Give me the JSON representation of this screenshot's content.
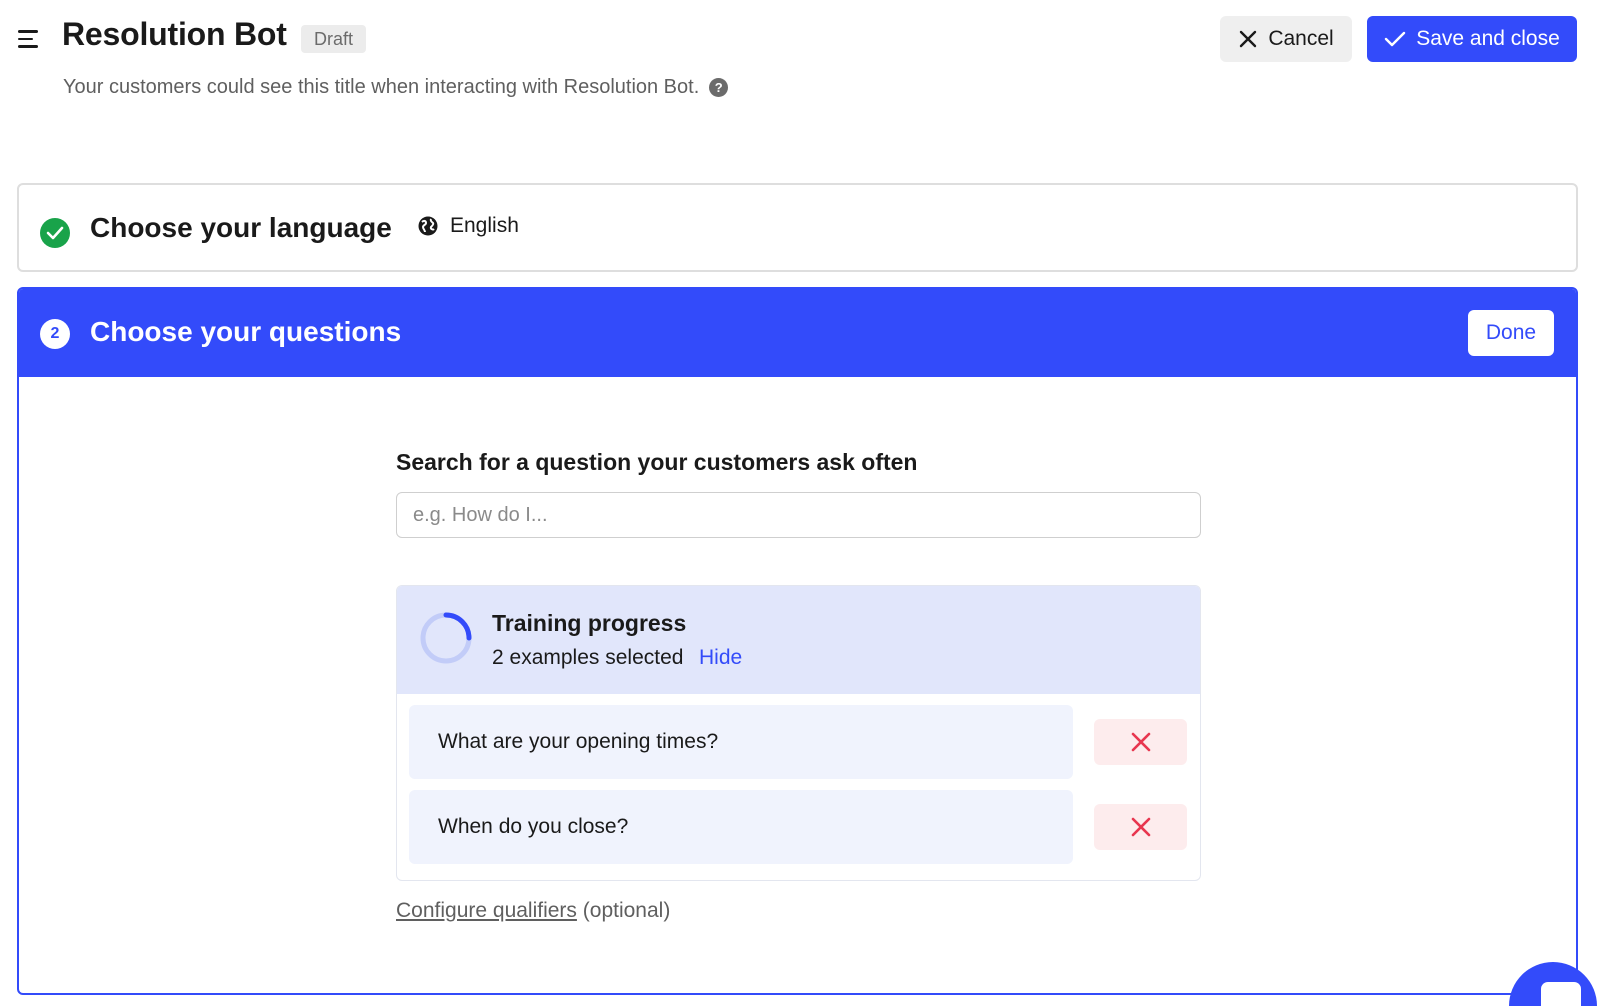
{
  "header": {
    "menu_icon": "hamburger-icon",
    "title": "Resolution Bot",
    "badge": "Draft",
    "subtitle": "Your customers could see this title when interacting with Resolution Bot.",
    "help_icon": "question-circle-icon",
    "help_glyph": "?",
    "cancel_label": "Cancel",
    "save_label": "Save and close"
  },
  "step1": {
    "status_icon": "check-circle-icon",
    "title": "Choose your language",
    "language_icon": "globe-icon",
    "language": "English"
  },
  "step2": {
    "number": "2",
    "title": "Choose your questions",
    "done_label": "Done",
    "search_label": "Search for a question your customers ask often",
    "search_placeholder": "e.g. How do I...",
    "search_value": "",
    "training": {
      "progress_icon": "progress-ring-icon",
      "title": "Training progress",
      "count_text": "2 examples selected",
      "hide_label": "Hide",
      "examples": [
        {
          "text": "What are your opening times?"
        },
        {
          "text": "When do you close?"
        }
      ]
    },
    "configure_link": "Configure qualifiers",
    "configure_suffix": "(optional)"
  },
  "colors": {
    "accent": "#334bfa",
    "success": "#19a34a",
    "danger": "#e8364f",
    "training_bg": "#e1e6fb",
    "example_bg": "#f0f3fd"
  },
  "messenger": {
    "icon": "chat-bubble-icon"
  }
}
